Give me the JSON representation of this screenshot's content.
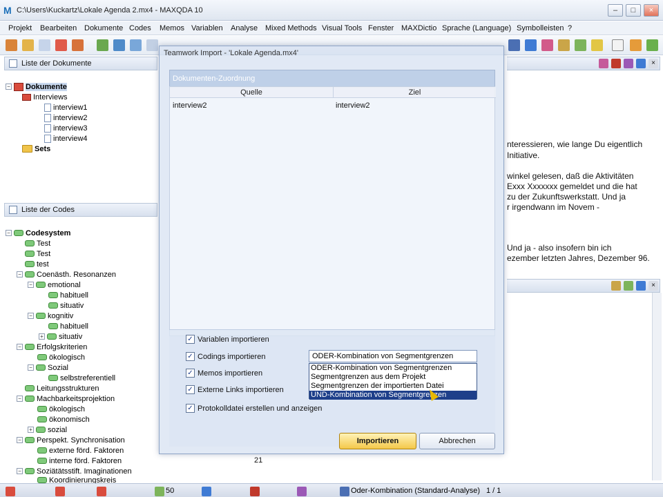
{
  "window": {
    "title": "C:\\Users\\Kuckartz\\Lokale Agenda 2.mx4 - MAXQDA 10"
  },
  "menu": [
    "Projekt",
    "Bearbeiten",
    "Dokumente",
    "Codes",
    "Memos",
    "Variablen",
    "Analyse",
    "Mixed Methods",
    "Visual Tools",
    "Fenster",
    "MAXDictio",
    "Sprache (Language)",
    "Symbolleisten",
    "?"
  ],
  "documents_panel": {
    "title": "Liste der Dokumente",
    "root": "Dokumente",
    "group": "Interviews",
    "docs": [
      "interview1",
      "interview2",
      "interview3",
      "interview4"
    ],
    "sets": "Sets"
  },
  "codes_panel": {
    "title": "Liste der Codes",
    "root": "Codesystem",
    "codes": [
      "Test",
      "Test",
      "test",
      "Coenästh. Resonanzen",
      "emotional",
      "habituell",
      "situativ",
      "kognitiv",
      "habituell",
      "situativ",
      "Erfolgskriterien",
      "ökologisch",
      "Sozial",
      "selbstreferentiell",
      "Leitungsstrukturen",
      "Machbarkeitsprojektion",
      "ökologisch",
      "ökonomisch",
      "sozial",
      "Perspekt. Synchronisation",
      "externe förd. Faktoren",
      "interne förd. Faktoren",
      "Soziätätsstift. Imaginationen",
      "Koordinierungskreis"
    ],
    "count_value": "21"
  },
  "dialog": {
    "title": "Teamwork Import  -  'Lokale Agenda.mx4'",
    "section": "Dokumenten-Zuordnung",
    "col_source": "Quelle",
    "col_target": "Ziel",
    "source_doc": "interview2",
    "target_doc": "interview2",
    "options": {
      "variables": "Variablen importieren",
      "codings": "Codings importieren",
      "memos": "Memos importieren",
      "links": "Externe Links importieren",
      "protocol": "Protokolldatei erstellen und anzeigen"
    },
    "combo_value": "ODER-Kombination von Segmentgrenzen",
    "dropdown_options": [
      "ODER-Kombination von Segmentgrenzen",
      "Segmentgrenzen aus dem Projekt",
      "Segmentgrenzen der importierten Datei",
      "UND-Kombination von Segmentgrenzen"
    ],
    "import_button": "Importieren",
    "cancel_button": "Abbrechen"
  },
  "right_text": {
    "line1": "nteressieren, wie lange Du eigentlich",
    "line2": "Initiative.",
    "line3": "winkel gelesen, daß die Aktivitäten",
    "line4": "Exxx Xxxxxxx gemeldet und die hat",
    "line5": "zu der Zukunftswerkstatt. Und ja",
    "line6": "r irgendwann im Novem -",
    "line7": "Und ja - also insofern bin ich",
    "line8": "ezember letzten Jahres, Dezember 96."
  },
  "statusbar": {
    "count": "50",
    "mode": "Oder-Kombination (Standard-Analyse)",
    "page": "1 / 1"
  }
}
